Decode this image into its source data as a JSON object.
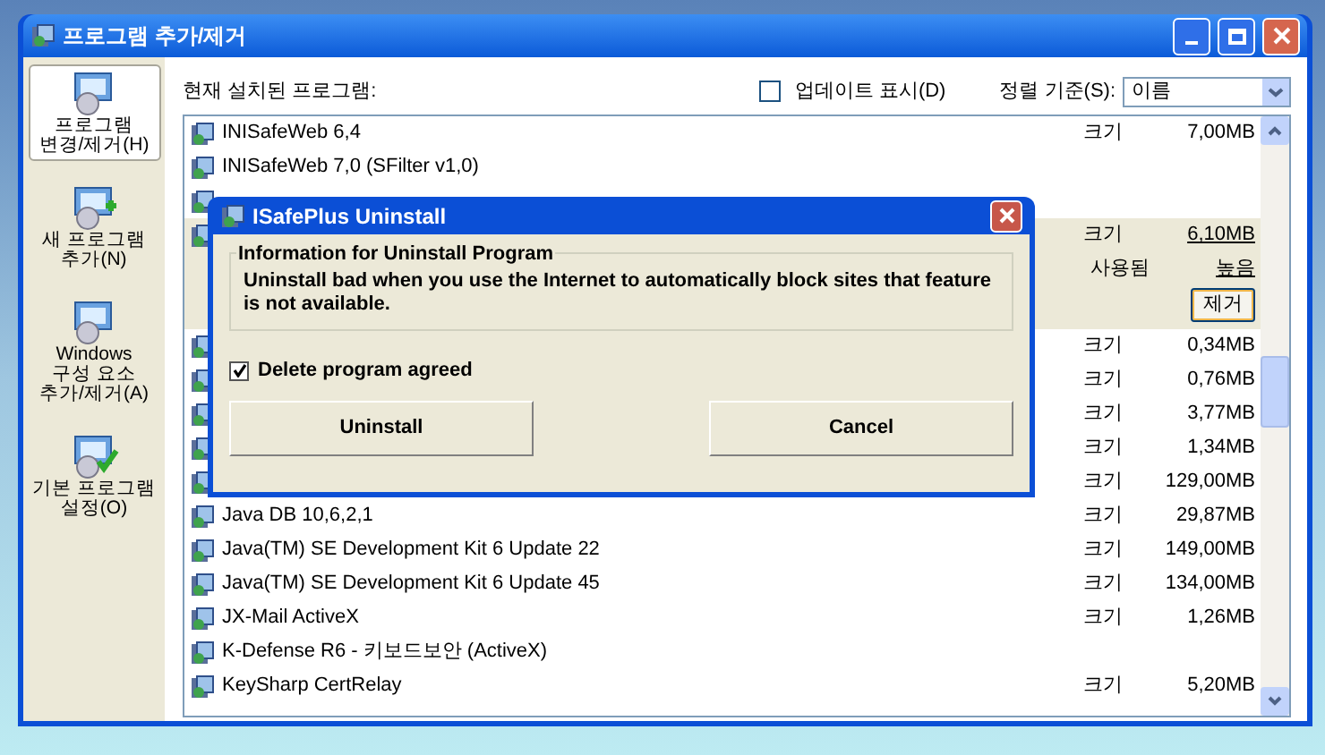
{
  "window": {
    "title": "프로그램 추가/제거"
  },
  "sidebar": {
    "items": [
      {
        "lines": [
          "프로그램",
          "변경/제거(H)"
        ],
        "selected": true
      },
      {
        "lines": [
          "새 프로그램",
          "추가(N)"
        ],
        "selected": false
      },
      {
        "lines": [
          "Windows",
          "구성 요소",
          "추가/제거(A)"
        ],
        "selected": false
      },
      {
        "lines": [
          "기본 프로그램",
          "설정(O)"
        ],
        "selected": false
      }
    ]
  },
  "header": {
    "label": "현재 설치된 프로그램:",
    "show_updates": {
      "label": "업데이트 표시(D)",
      "checked": false
    },
    "sort": {
      "label": "정렬 기준(S):",
      "value": "이름"
    }
  },
  "programs": [
    {
      "name": "INISafeWeb 6,4",
      "size_label": "크기",
      "size": "7,00MB",
      "selected": false
    },
    {
      "name": "INISafeWeb 7,0 (SFilter v1,0)",
      "selected": false
    },
    {
      "selected": false
    },
    {
      "selected": true,
      "size_label": "크기",
      "size": "6,10MB",
      "usage_label": "사용됨",
      "usage": "높음",
      "remove_button": "제거"
    },
    {
      "size_label": "크기",
      "size": "0,34MB",
      "selected": false
    },
    {
      "size_label": "크기",
      "size": "0,76MB",
      "selected": false
    },
    {
      "size_label": "크기",
      "size": "3,77MB",
      "selected": false
    },
    {
      "size_label": "크기",
      "size": "1,34MB",
      "selected": false
    },
    {
      "size_label": "크기",
      "size": "129,00MB",
      "selected": false
    },
    {
      "name": "Java DB 10,6,2,1",
      "size_label": "크기",
      "size": "29,87MB",
      "selected": false
    },
    {
      "name": "Java(TM) SE Development Kit 6 Update 22",
      "size_label": "크기",
      "size": "149,00MB",
      "selected": false
    },
    {
      "name": "Java(TM) SE Development Kit 6 Update 45",
      "size_label": "크기",
      "size": "134,00MB",
      "selected": false
    },
    {
      "name": "JX-Mail ActiveX",
      "size_label": "크기",
      "size": "1,26MB",
      "selected": false
    },
    {
      "name": "K-Defense R6 - 키보드보안 (ActiveX)",
      "selected": false
    },
    {
      "name": "KeySharp CertRelay",
      "size_label": "크기",
      "size": "5,20MB",
      "selected": false
    }
  ],
  "dialog": {
    "title": "ISafePlus Uninstall",
    "group_title": "Information for Uninstall Program",
    "message": "Uninstall bad when you use the Internet to automatically block sites that feature is not available.",
    "agree": {
      "label": "Delete program agreed",
      "checked": true
    },
    "buttons": [
      "Uninstall",
      "Cancel"
    ]
  }
}
